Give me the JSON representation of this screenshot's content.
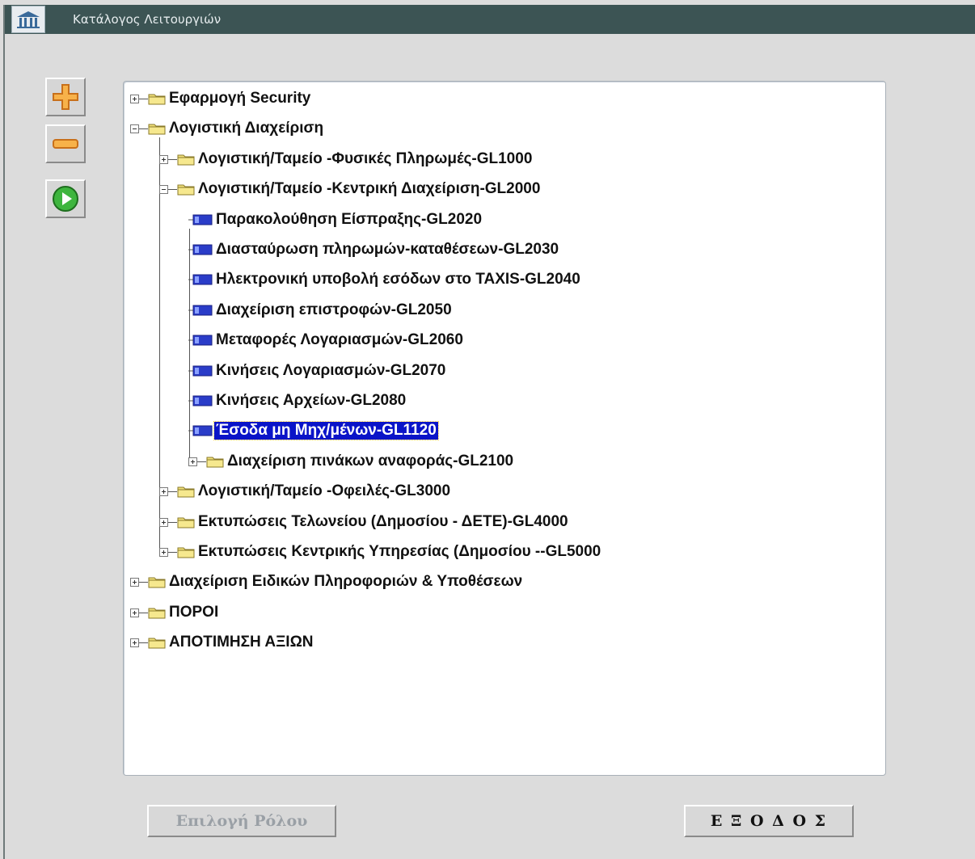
{
  "window": {
    "title": "Κατάλογος Λειτουργιών",
    "logo_icon": "ministry-building-icon"
  },
  "toolbar": {
    "expand_icon": "plus-icon",
    "collapse_icon": "minus-icon",
    "run_icon": "play-icon"
  },
  "tree": {
    "nodes": [
      {
        "label": "Εφαρμογή Security",
        "level": 0,
        "type": "folder",
        "state": "collapsed"
      },
      {
        "label": "Λογιστική Διαχείριση",
        "level": 0,
        "type": "folder",
        "state": "expanded"
      },
      {
        "label": "Λογιστική/Ταμείο -Φυσικές Πληρωμές-GL1000",
        "level": 1,
        "type": "folder",
        "state": "collapsed"
      },
      {
        "label": "Λογιστική/Ταμείο -Κεντρική Διαχείριση-GL2000",
        "level": 1,
        "type": "folder",
        "state": "expanded"
      },
      {
        "label": "Παρακολούθηση Είσπραξης-GL2020",
        "level": 2,
        "type": "leaf"
      },
      {
        "label": "Διασταύρωση πληρωμών-καταθέσεων-GL2030",
        "level": 2,
        "type": "leaf"
      },
      {
        "label": "Ηλεκτρονική υποβολή εσόδων στο TAXIS-GL2040",
        "level": 2,
        "type": "leaf"
      },
      {
        "label": "Διαχείριση επιστροφών-GL2050",
        "level": 2,
        "type": "leaf"
      },
      {
        "label": "Μεταφορές Λογαριασμών-GL2060",
        "level": 2,
        "type": "leaf"
      },
      {
        "label": "Κινήσεις Λογαριασμών-GL2070",
        "level": 2,
        "type": "leaf"
      },
      {
        "label": "Κινήσεις Αρχείων-GL2080",
        "level": 2,
        "type": "leaf"
      },
      {
        "label": "Έσοδα μη Μηχ/μένων-GL1120",
        "level": 2,
        "type": "leaf",
        "selected": true
      },
      {
        "label": "Διαχείριση πινάκων αναφοράς-GL2100",
        "level": 2,
        "type": "folder",
        "state": "collapsed"
      },
      {
        "label": "Λογιστική/Ταμείο -Οφειλές-GL3000",
        "level": 1,
        "type": "folder",
        "state": "collapsed"
      },
      {
        "label": "Εκτυπώσεις  Τελωνείου (Δημοσίου - ΔΕΤΕ)-GL4000",
        "level": 1,
        "type": "folder",
        "state": "collapsed"
      },
      {
        "label": "Εκτυπώσεις  Κεντρικής Υπηρεσίας (Δημοσίου --GL5000",
        "level": 1,
        "type": "folder",
        "state": "collapsed"
      },
      {
        "label": "Διαχείριση Ειδικών Πληροφοριών & Υποθέσεων",
        "level": 0,
        "type": "folder",
        "state": "collapsed"
      },
      {
        "label": "ΠΟΡΟΙ",
        "level": 0,
        "type": "folder",
        "state": "collapsed"
      },
      {
        "label": "ΑΠΟΤΙΜΗΣΗ ΑΞΙΩΝ",
        "level": 0,
        "type": "folder",
        "state": "collapsed"
      }
    ]
  },
  "buttons": {
    "select_role": "Επιλογή Ρόλου",
    "exit": "Ε Ξ Ο Δ Ο Σ"
  },
  "colors": {
    "titlebar": "#3c5454",
    "selection": "#0a14c8",
    "folder": "#f0e07a",
    "leaf": "#2a3cc8"
  }
}
